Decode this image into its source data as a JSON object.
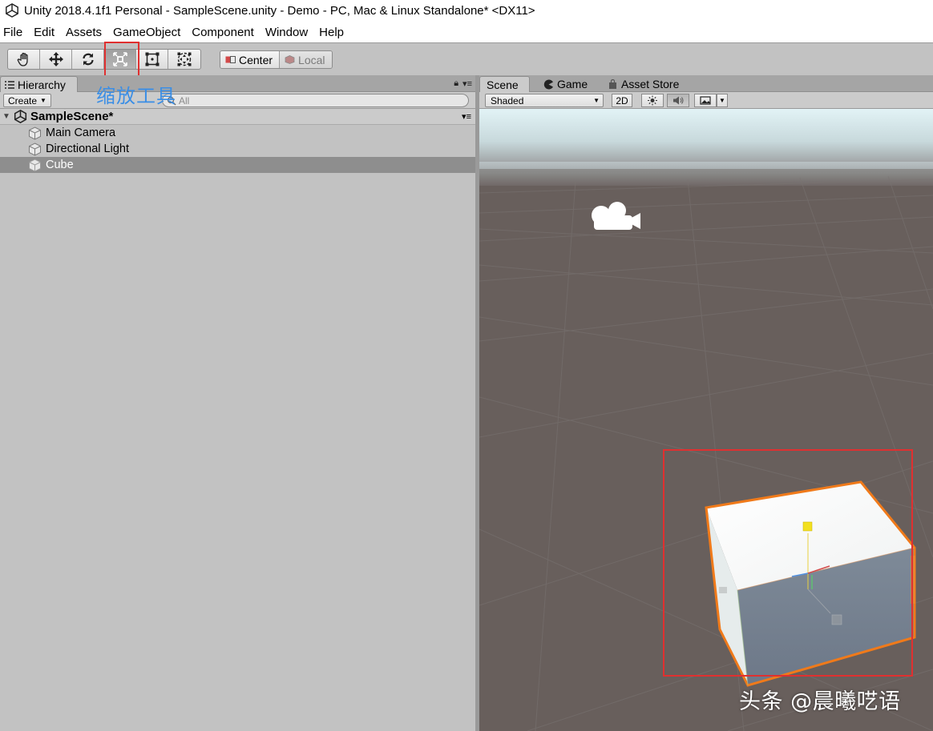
{
  "window": {
    "title": "Unity 2018.4.1f1 Personal - SampleScene.unity - Demo - PC, Mac & Linux Standalone* <DX11>"
  },
  "menu": [
    "File",
    "Edit",
    "Assets",
    "GameObject",
    "Component",
    "Window",
    "Help"
  ],
  "toolbar": {
    "tools": [
      {
        "name": "hand-tool",
        "icon": "hand-icon",
        "active": false
      },
      {
        "name": "move-tool",
        "icon": "move-arrows-icon",
        "active": false
      },
      {
        "name": "rotate-tool",
        "icon": "rotate-icon",
        "active": false
      },
      {
        "name": "scale-tool",
        "icon": "scale-icon",
        "active": true
      },
      {
        "name": "rect-tool",
        "icon": "rect-icon",
        "active": false
      },
      {
        "name": "transform-tool",
        "icon": "transform-icon",
        "active": false
      }
    ],
    "pivot_label": "Center",
    "space_label": "Local"
  },
  "annotation": {
    "tool_caption": "缩放工具"
  },
  "hierarchy": {
    "tab_label": "Hierarchy",
    "create_label": "Create",
    "search_placeholder": "All",
    "scene_name": "SampleScene*",
    "items": [
      {
        "label": "Main Camera",
        "selected": false
      },
      {
        "label": "Directional Light",
        "selected": false
      },
      {
        "label": "Cube",
        "selected": true
      }
    ]
  },
  "scene_panel": {
    "tabs": [
      "Scene",
      "Game",
      "Asset Store"
    ],
    "active_tab": "Scene",
    "shading_mode": "Shaded",
    "mode_2d_label": "2D"
  },
  "watermark": "头条 @晨曦呓语",
  "colors": {
    "highlight_red": "#e03030",
    "caption_blue": "#3a8ee6",
    "selection_orange": "#f07a1a"
  }
}
